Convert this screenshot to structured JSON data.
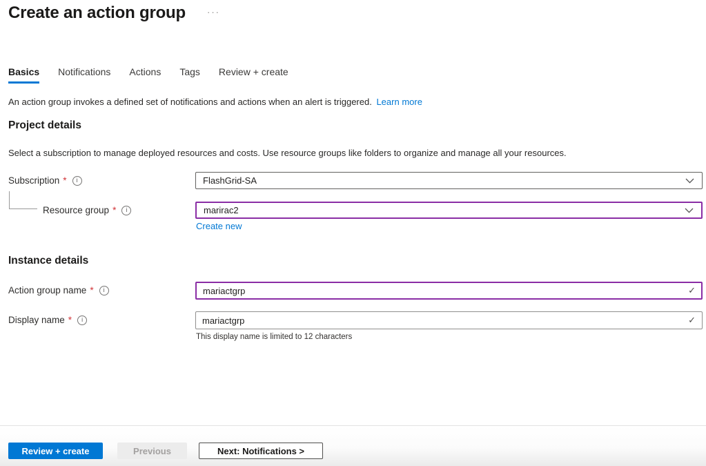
{
  "ui": {
    "required_marker": "*",
    "info_glyph": "i"
  },
  "icons": {
    "more_options": "···",
    "valid_check": "✓"
  },
  "header": {
    "title": "Create an action group"
  },
  "tabs": [
    {
      "label": "Basics",
      "active": true
    },
    {
      "label": "Notifications",
      "active": false
    },
    {
      "label": "Actions",
      "active": false
    },
    {
      "label": "Tags",
      "active": false
    },
    {
      "label": "Review + create",
      "active": false
    }
  ],
  "intro": {
    "text": "An action group invokes a defined set of notifications and actions when an alert is triggered.",
    "link_label": "Learn more"
  },
  "project_details": {
    "heading": "Project details",
    "description": "Select a subscription to manage deployed resources and costs. Use resource groups like folders to organize and manage all your resources.",
    "subscription": {
      "label": "Subscription",
      "value": "FlashGrid-SA"
    },
    "resource_group": {
      "label": "Resource group",
      "value": "marirac2",
      "create_new_label": "Create new"
    }
  },
  "instance_details": {
    "heading": "Instance details",
    "action_group_name": {
      "label": "Action group name",
      "value": "mariactgrp"
    },
    "display_name": {
      "label": "Display name",
      "value": "mariactgrp",
      "helper": "This display name is limited to 12 characters"
    }
  },
  "footer": {
    "review_create_label": "Review + create",
    "previous_label": "Previous",
    "next_label": "Next: Notifications >"
  },
  "colors": {
    "accent": "#0078d4",
    "link": "#0078d4",
    "dirty_field_border": "#8a2da5",
    "required": "#d13438"
  }
}
